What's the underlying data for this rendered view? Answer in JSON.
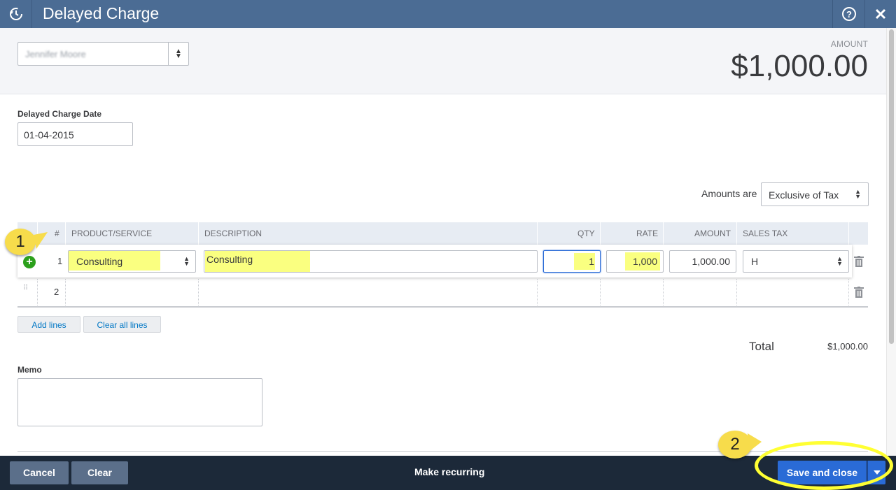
{
  "header": {
    "title": "Delayed Charge",
    "icons": [
      "history-icon",
      "help-icon",
      "close-icon"
    ]
  },
  "customer": {
    "value": "Jennifer Moore"
  },
  "amount": {
    "label": "AMOUNT",
    "value": "$1,000.00"
  },
  "date": {
    "label": "Delayed Charge Date",
    "value": "01-04-2015"
  },
  "tax_mode": {
    "label": "Amounts are",
    "value": "Exclusive of Tax"
  },
  "table": {
    "columns": [
      "#",
      "PRODUCT/SERVICE",
      "DESCRIPTION",
      "QTY",
      "RATE",
      "AMOUNT",
      "SALES TAX"
    ],
    "rows": [
      {
        "num": "1",
        "product": "Consulting",
        "description": "Consulting",
        "qty": "1",
        "rate": "1,000",
        "amount": "1,000.00",
        "tax": "H"
      },
      {
        "num": "2",
        "product": "",
        "description": "",
        "qty": "",
        "rate": "",
        "amount": "",
        "tax": ""
      }
    ]
  },
  "buttons": {
    "add_lines": "Add lines",
    "clear_all": "Clear all lines"
  },
  "total": {
    "label": "Total",
    "value": "$1,000.00"
  },
  "memo": {
    "label": "Memo",
    "value": ""
  },
  "footer": {
    "cancel": "Cancel",
    "clear": "Clear",
    "make_recurring": "Make recurring",
    "save": "Save and close"
  },
  "annotations": {
    "step1": "1",
    "step2": "2"
  },
  "colors": {
    "header": "#4b6c94",
    "footer": "#1c2939",
    "save": "#2a6bd6",
    "highlight": "#faff80",
    "callout": "#f7dc4b"
  }
}
